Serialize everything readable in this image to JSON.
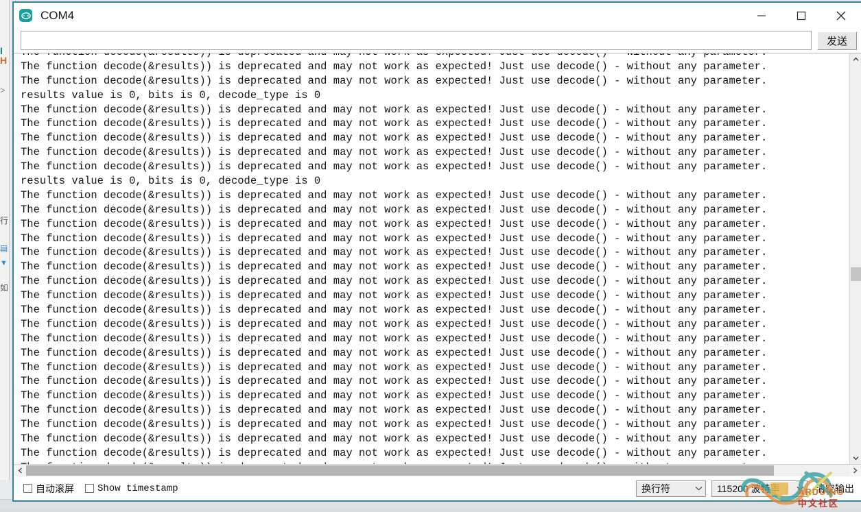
{
  "window": {
    "title": "COM4",
    "app_icon": "arduino-icon",
    "minimize_label": "minimize-icon",
    "maximize_label": "maximize-icon",
    "close_label": "close-icon",
    "border_color": "#31859c"
  },
  "send_row": {
    "input_value": "",
    "input_placeholder": "",
    "send_label": "发送"
  },
  "console": {
    "deprecation_line": "The function decode(&results)) is deprecated and may not work as expected! Just use decode() - without any parameter.",
    "results_line": "results value is 0, bits is 0, decode_type is 0",
    "lines": [
      "The function decode(&results)) is deprecated and may not work as expected! Just use decode() - without any parameter.",
      "The function decode(&results)) is deprecated and may not work as expected! Just use decode() - without any parameter.",
      "The function decode(&results)) is deprecated and may not work as expected! Just use decode() - without any parameter.",
      "results value is 0, bits is 0, decode_type is 0",
      "The function decode(&results)) is deprecated and may not work as expected! Just use decode() - without any parameter.",
      "The function decode(&results)) is deprecated and may not work as expected! Just use decode() - without any parameter.",
      "The function decode(&results)) is deprecated and may not work as expected! Just use decode() - without any parameter.",
      "The function decode(&results)) is deprecated and may not work as expected! Just use decode() - without any parameter.",
      "The function decode(&results)) is deprecated and may not work as expected! Just use decode() - without any parameter.",
      "results value is 0, bits is 0, decode_type is 0",
      "The function decode(&results)) is deprecated and may not work as expected! Just use decode() - without any parameter.",
      "The function decode(&results)) is deprecated and may not work as expected! Just use decode() - without any parameter.",
      "The function decode(&results)) is deprecated and may not work as expected! Just use decode() - without any parameter.",
      "The function decode(&results)) is deprecated and may not work as expected! Just use decode() - without any parameter.",
      "The function decode(&results)) is deprecated and may not work as expected! Just use decode() - without any parameter.",
      "The function decode(&results)) is deprecated and may not work as expected! Just use decode() - without any parameter.",
      "The function decode(&results)) is deprecated and may not work as expected! Just use decode() - without any parameter.",
      "The function decode(&results)) is deprecated and may not work as expected! Just use decode() - without any parameter.",
      "The function decode(&results)) is deprecated and may not work as expected! Just use decode() - without any parameter.",
      "The function decode(&results)) is deprecated and may not work as expected! Just use decode() - without any parameter.",
      "The function decode(&results)) is deprecated and may not work as expected! Just use decode() - without any parameter.",
      "The function decode(&results)) is deprecated and may not work as expected! Just use decode() - without any parameter.",
      "The function decode(&results)) is deprecated and may not work as expected! Just use decode() - without any parameter.",
      "The function decode(&results)) is deprecated and may not work as expected! Just use decode() - without any parameter.",
      "The function decode(&results)) is deprecated and may not work as expected! Just use decode() - without any parameter.",
      "The function decode(&results)) is deprecated and may not work as expected! Just use decode() - without any parameter.",
      "The function decode(&results)) is deprecated and may not work as expected! Just use decode() - without any parameter.",
      "The function decode(&results)) is deprecated and may not work as expected! Just use decode() - without any parameter.",
      "The function decode(&results)) is deprecated and may not work as expected! Just use decode() - without any parameter.",
      "The function decode(&results)) is deprecated and may not work as expected! Just use decode() - without any parameter."
    ]
  },
  "scrollbars": {
    "v_up_icon": "chevron-up-icon",
    "v_down_icon": "chevron-down-icon",
    "h_left_icon": "chevron-left-icon",
    "h_right_icon": "chevron-right-icon"
  },
  "status_bar": {
    "autoscroll_label": "自动滚屏",
    "autoscroll_checked": false,
    "timestamp_label": "Show timestamp",
    "timestamp_checked": false,
    "newline_value": "换行符",
    "baud_value": "115200 波特率",
    "clear_label": "清空输出"
  },
  "watermark": {
    "brand": "ARDUINO",
    "community": "中文社区",
    "teal": "#2f9e9e",
    "orange": "#e08a3c"
  },
  "ide_background": {
    "ghost_1": "I",
    "ghost_2": "H",
    "ghost_3": ">",
    "ghost_4": "行",
    "ghost_5": "▤",
    "ghost_6": "▼",
    "ghost_7": "如"
  }
}
